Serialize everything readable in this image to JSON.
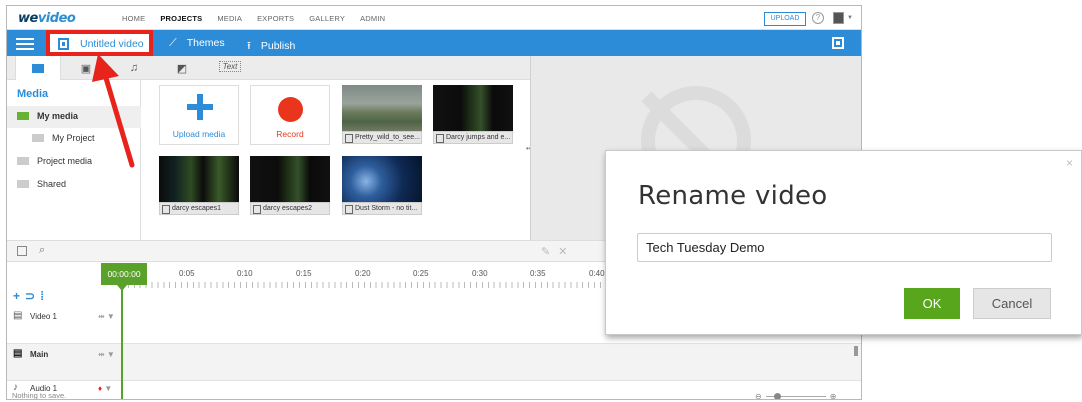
{
  "app": {
    "logo_prefix": "we",
    "logo_accent": "video",
    "nav": [
      "HOME",
      "PROJECTS",
      "MEDIA",
      "EXPORTS",
      "GALLERY",
      "ADMIN"
    ],
    "nav_active": "PROJECTS",
    "upload_label": "UPLOAD",
    "help_glyph": "?"
  },
  "toolbar": {
    "video_title": "Untitled video",
    "themes_label": "Themes",
    "publish_label": "Publish"
  },
  "media_tabs": {
    "text_tab": "Text"
  },
  "sidebar": {
    "title": "Media",
    "items": [
      {
        "label": "My media"
      },
      {
        "label": "My Project"
      },
      {
        "label": "Project media"
      },
      {
        "label": "Shared"
      }
    ]
  },
  "media_grid": {
    "upload_label": "Upload media",
    "record_label": "Record",
    "clips": [
      {
        "name": "Pretty_wild_to_see..."
      },
      {
        "name": "Darcy jumps and e..."
      },
      {
        "name": "darcy escapes1"
      },
      {
        "name": "darcy escapes2"
      },
      {
        "name": "Dust Storm - no tit..."
      }
    ]
  },
  "timeline": {
    "playhead": "00:00:00",
    "ticks": [
      "0:05",
      "0:10",
      "0:15",
      "0:20",
      "0:25",
      "0:30",
      "0:35",
      "0:40"
    ],
    "tracks": [
      {
        "name": "Video 1"
      },
      {
        "name": "Main"
      },
      {
        "name": "Audio 1"
      }
    ],
    "status": "Nothing to save."
  },
  "dialog": {
    "title": "Rename video",
    "input_value": "Tech Tuesday Demo",
    "ok_label": "OK",
    "cancel_label": "Cancel",
    "close_glyph": "×"
  },
  "colors": {
    "brand_blue": "#2d8cd7",
    "highlight_red": "#e8231c",
    "ok_green": "#58a61c",
    "playhead_green": "#59a12a"
  },
  "icons": [
    "menu-icon",
    "film-icon",
    "magic-wand-icon",
    "upload-arrow-icon",
    "expand-icon",
    "folder-icon",
    "music-note-icon",
    "transition-icon",
    "help-icon",
    "zoom-in-icon",
    "search-icon",
    "mic-icon",
    "close-icon"
  ]
}
